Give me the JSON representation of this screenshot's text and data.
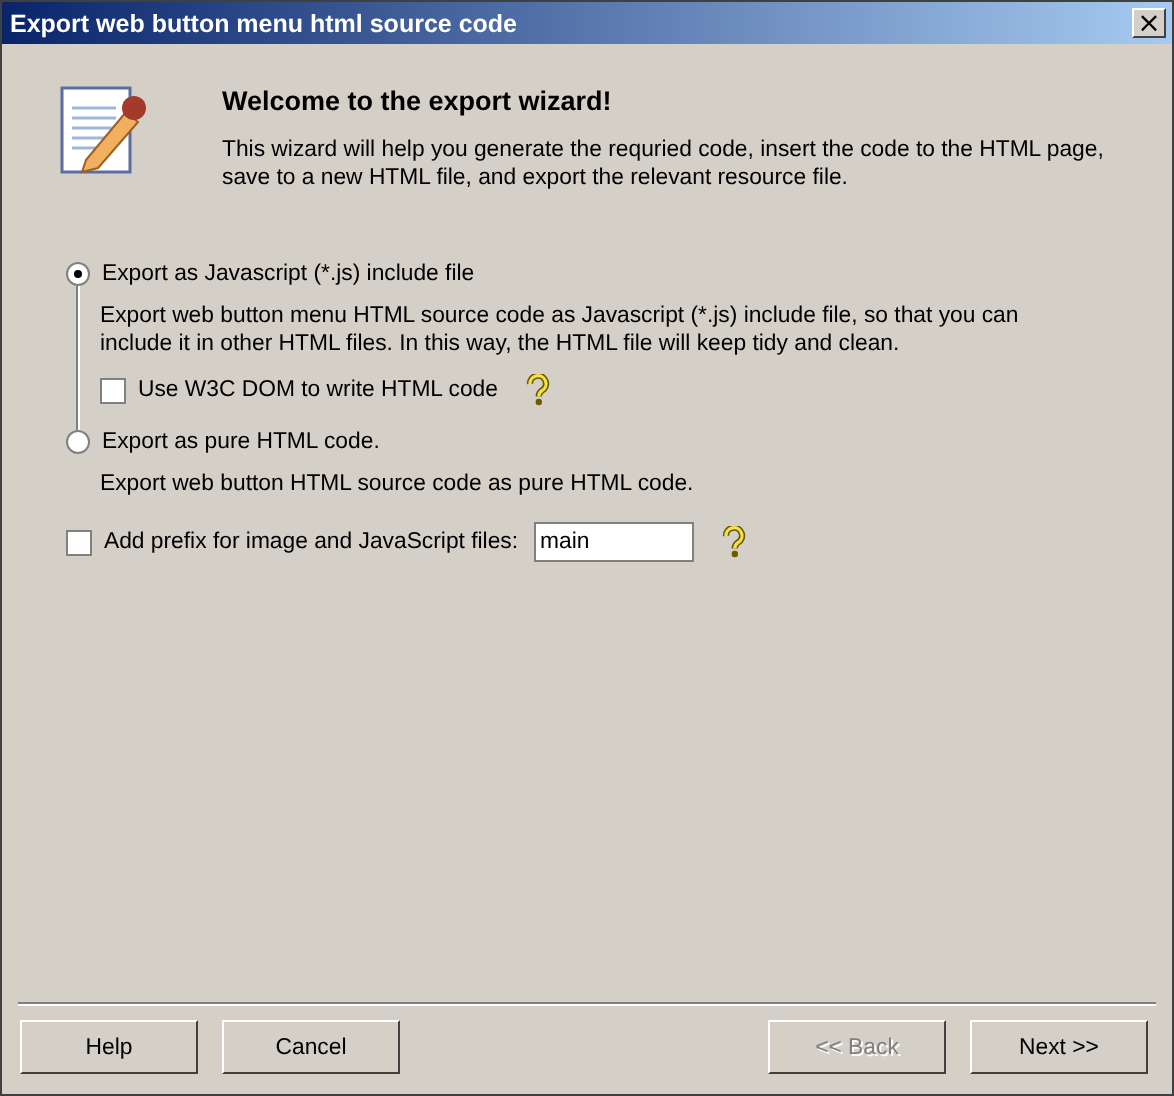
{
  "window": {
    "title": "Export web button menu html source code",
    "close": "×"
  },
  "header": {
    "title": "Welcome to the export wizard!",
    "description": "This wizard will help you generate the requried code, insert the code to the HTML page, save to a new HTML file, and export the relevant resource file."
  },
  "export_modes": [
    {
      "label": "Export as Javascript (*.js) include file",
      "selected": true,
      "description": "Export web button menu HTML source code as Javascript (*.js) include file, so that you can include it in other HTML files. In this way, the HTML file will keep tidy and clean.",
      "options": [
        {
          "label": "Use W3C DOM to write HTML code",
          "checked": false
        }
      ]
    },
    {
      "label": "Export as pure HTML code.",
      "selected": false,
      "description": "Export web button HTML source code as pure HTML code."
    }
  ],
  "prefix": {
    "label": "Add prefix for image and JavaScript files:",
    "checked": false,
    "value": "main"
  },
  "buttons_left": [
    {
      "label": "Help",
      "disabled": false
    },
    {
      "label": "Cancel",
      "disabled": false
    }
  ],
  "buttons_right": [
    {
      "label": "<< Back",
      "disabled": true
    },
    {
      "label": "Next >>",
      "disabled": false
    }
  ]
}
